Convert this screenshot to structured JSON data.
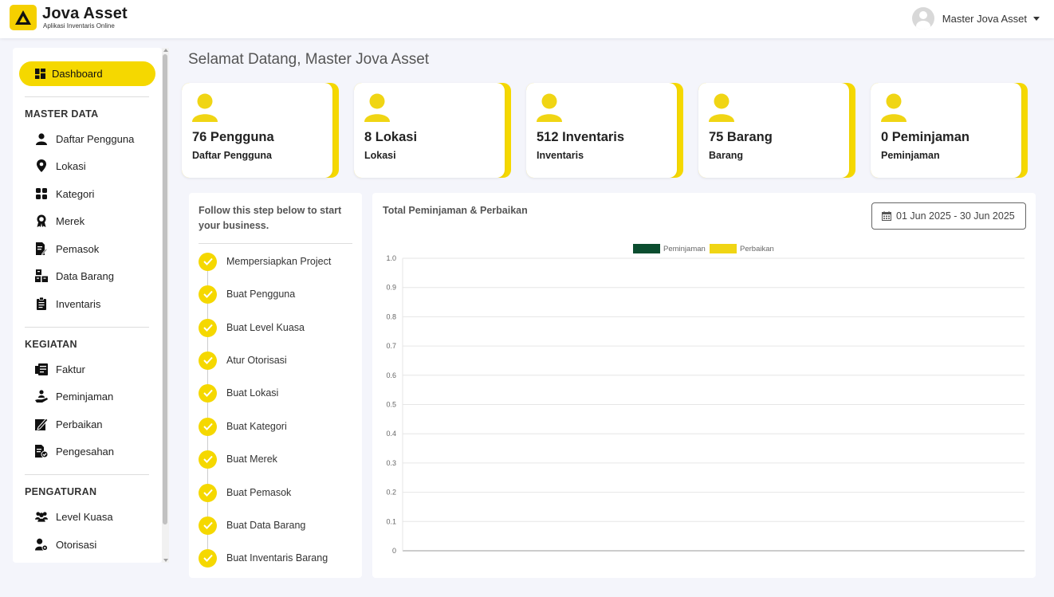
{
  "brand": {
    "name": "Jova Asset",
    "tagline": "Aplikasi Inventaris Online",
    "color": "#f5d800"
  },
  "user": {
    "name": "Master Jova Asset"
  },
  "sidebar": {
    "dashboard_label": "Dashboard",
    "sections": [
      {
        "title": "MASTER DATA",
        "items": [
          {
            "label": "Daftar Pengguna",
            "icon": "user-icon"
          },
          {
            "label": "Lokasi",
            "icon": "map-pin-icon"
          },
          {
            "label": "Kategori",
            "icon": "grid-icon"
          },
          {
            "label": "Merek",
            "icon": "award-icon"
          },
          {
            "label": "Pemasok",
            "icon": "file-edit-icon"
          },
          {
            "label": "Data Barang",
            "icon": "boxes-icon"
          },
          {
            "label": "Inventaris",
            "icon": "clipboard-icon"
          }
        ]
      },
      {
        "title": "KEGIATAN",
        "items": [
          {
            "label": "Faktur",
            "icon": "invoice-icon"
          },
          {
            "label": "Peminjaman",
            "icon": "hand-holding-icon"
          },
          {
            "label": "Perbaikan",
            "icon": "repair-icon"
          },
          {
            "label": "Pengesahan",
            "icon": "file-check-icon"
          }
        ]
      },
      {
        "title": "PENGATURAN",
        "items": [
          {
            "label": "Level Kuasa",
            "icon": "users-icon"
          },
          {
            "label": "Otorisasi",
            "icon": "user-cog-icon"
          }
        ]
      }
    ]
  },
  "welcome": "Selamat Datang, Master Jova Asset",
  "stats": [
    {
      "value": "76 Pengguna",
      "label": "Daftar Pengguna"
    },
    {
      "value": "8 Lokasi",
      "label": "Lokasi"
    },
    {
      "value": "512 Inventaris",
      "label": "Inventaris"
    },
    {
      "value": "75 Barang",
      "label": "Barang"
    },
    {
      "value": "0 Peminjaman",
      "label": "Peminjaman"
    }
  ],
  "steps": {
    "title": "Follow this step below to start your business.",
    "items": [
      "Mempersiapkan Project",
      "Buat Pengguna",
      "Buat Level Kuasa",
      "Atur Otorisasi",
      "Buat Lokasi",
      "Buat Kategori",
      "Buat Merek",
      "Buat Pemasok",
      "Buat Data Barang",
      "Buat Inventaris Barang"
    ]
  },
  "chart": {
    "title": "Total Peminjaman & Perbaikan",
    "date_range": "01 Jun 2025 - 30 Jun 2025"
  },
  "chart_data": {
    "type": "bar",
    "title": "Total Peminjaman & Perbaikan",
    "categories": [],
    "series": [
      {
        "name": "Peminjaman",
        "color": "#0b4d2f",
        "values": []
      },
      {
        "name": "Perbaikan",
        "color": "#f0d514",
        "values": []
      }
    ],
    "ylim": [
      0,
      1
    ],
    "yticks": [
      "0",
      "0.1",
      "0.2",
      "0.3",
      "0.4",
      "0.5",
      "0.6",
      "0.7",
      "0.8",
      "0.9",
      "1.0"
    ],
    "grid": true,
    "legend": "top-center"
  }
}
